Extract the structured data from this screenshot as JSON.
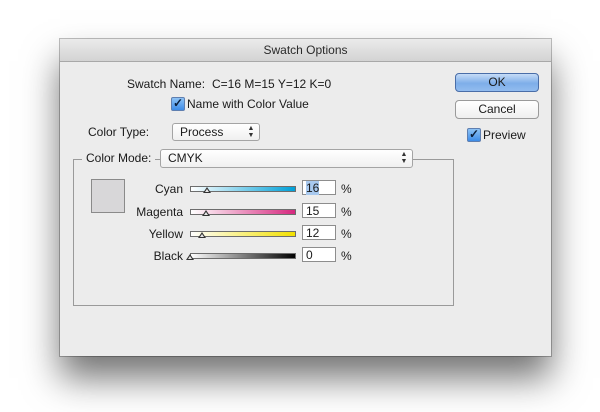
{
  "dialog": {
    "title": "Swatch Options",
    "swatch_name_label": "Swatch Name:",
    "swatch_name_value": "C=16 M=15 Y=12 K=0",
    "name_with_color_value_label": "Name with Color Value",
    "name_with_color_value_checked": true,
    "color_type_label": "Color Type:",
    "color_type_value": "Process",
    "color_mode_label": "Color Mode:",
    "color_mode_value": "CMYK",
    "ok_label": "OK",
    "cancel_label": "Cancel",
    "preview_label": "Preview",
    "preview_checked": true,
    "swatch_color": "#d8d7d9",
    "checkmark": "✓",
    "channels": [
      {
        "name": "Cyan",
        "value": "16",
        "unit": "%",
        "fraction": 0.16,
        "color": "#00a0d8"
      },
      {
        "name": "Magenta",
        "value": "15",
        "unit": "%",
        "fraction": 0.15,
        "color": "#d6297f"
      },
      {
        "name": "Yellow",
        "value": "12",
        "unit": "%",
        "fraction": 0.12,
        "color": "#f2e000"
      },
      {
        "name": "Black",
        "value": "0",
        "unit": "%",
        "fraction": 0.0,
        "color": "#000000"
      }
    ]
  }
}
